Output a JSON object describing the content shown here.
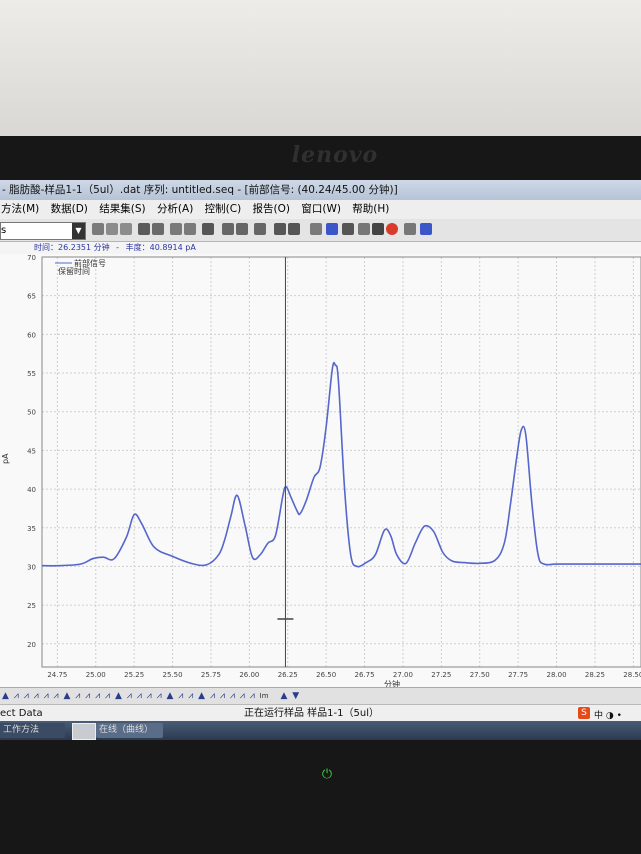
{
  "window": {
    "title": "- 脂肪酸-样品1-1（5ul）.dat 序列: untitled.seq - [前部信号: (40.24/45.00 分钟)]"
  },
  "menu": [
    {
      "label": "方法(M)"
    },
    {
      "label": "数据(D)"
    },
    {
      "label": "结果集(S)"
    },
    {
      "label": "分析(A)"
    },
    {
      "label": "控制(C)"
    },
    {
      "label": "报告(O)"
    },
    {
      "label": "窗口(W)"
    },
    {
      "label": "帮助(H)"
    }
  ],
  "toolbar": {
    "combo_value": "s"
  },
  "cursor_info": {
    "time_label": "时间：",
    "time_value": "26.2351 分钟",
    "sep": "-",
    "intensity_label": "丰度：",
    "intensity_value": "40.8914 pA"
  },
  "chart_data": {
    "type": "line",
    "legend": [
      "前部信号",
      "保留时间"
    ],
    "ylabel": "pA",
    "xlabel": "分钟",
    "xlim": [
      24.65,
      28.55
    ],
    "ylim": [
      17,
      70
    ],
    "x_ticks": [
      "24.75",
      "25.00",
      "25.25",
      "25.50",
      "25.75",
      "26.00",
      "26.25",
      "26.50",
      "26.75",
      "27.00",
      "27.25",
      "27.50",
      "27.75",
      "28.00",
      "28.25",
      "28.50"
    ],
    "y_ticks": [
      "20",
      "25",
      "30",
      "35",
      "40",
      "45",
      "50",
      "55",
      "60",
      "65",
      "70"
    ],
    "cursor_x": 26.235,
    "series": [
      {
        "color": "#5566cc",
        "x": [
          24.65,
          24.75,
          24.9,
          24.98,
          25.05,
          25.12,
          25.2,
          25.25,
          25.3,
          25.38,
          25.5,
          25.62,
          25.72,
          25.8,
          25.84,
          25.88,
          25.92,
          25.97,
          26.02,
          26.07,
          26.12,
          26.17,
          26.22,
          26.24,
          26.27,
          26.31,
          26.33,
          26.37,
          26.42,
          26.46,
          26.5,
          26.54,
          26.56,
          26.58,
          26.62,
          26.66,
          26.7,
          26.76,
          26.82,
          26.88,
          26.92,
          26.96,
          27.02,
          27.08,
          27.14,
          27.2,
          27.26,
          27.32,
          27.4,
          27.5,
          27.6,
          27.66,
          27.7,
          27.74,
          27.77,
          27.8,
          27.84,
          27.88,
          27.92,
          28.0,
          28.2,
          28.55
        ],
        "values": [
          30.1,
          30.1,
          30.3,
          31.0,
          31.2,
          31.0,
          33.8,
          36.7,
          35.5,
          32.5,
          31.3,
          30.4,
          30.2,
          31.5,
          33.5,
          36.5,
          39.2,
          35.5,
          31.2,
          31.5,
          33.0,
          34.0,
          39.3,
          40.3,
          39.0,
          37.2,
          36.8,
          38.5,
          41.5,
          42.8,
          48.0,
          55.5,
          56.0,
          54.0,
          40.0,
          31.5,
          30.0,
          30.5,
          31.5,
          34.7,
          34.0,
          31.5,
          30.4,
          33.0,
          35.2,
          34.5,
          31.8,
          30.7,
          30.5,
          30.4,
          30.8,
          33.0,
          38.0,
          44.0,
          47.6,
          47.0,
          38.0,
          31.5,
          30.3,
          30.3,
          30.3,
          30.3
        ]
      }
    ]
  },
  "iconstrip": {
    "items": "▲ ⩘ ⩘ ⩘ ⩘ ⩘ ▲ ⩘ ⩘ ⩘ ⩘ ▲ ⩘ ⩘ ⩘ ⩘ ▲ ⩘ ⩘ ▲ ⩘ ⩘ ⩘ ⩘ ⩘",
    "small": "Im",
    "arrows": "▲ ▼"
  },
  "statusbar": {
    "left": "ect Data",
    "center": "正在运行样品 样品1-1（5ul）"
  },
  "taskbar": {
    "task1": "工作方法",
    "task2": "在线（曲线）"
  }
}
